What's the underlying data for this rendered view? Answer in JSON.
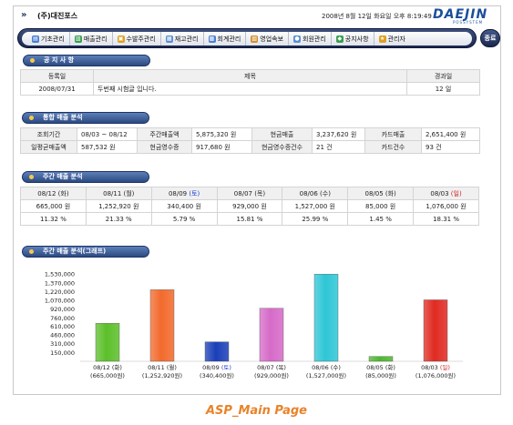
{
  "header": {
    "company": "(주)대진포스",
    "datetime": "2008년 8월 12일 화요일 오후 8:19:49",
    "logo_main": "DAEJIN",
    "logo_sub": "POSSYSTEM"
  },
  "nav": {
    "items": [
      {
        "label": "기초관리",
        "icon": "folder-icon",
        "color": "#4a7fd0"
      },
      {
        "label": "매출관리",
        "icon": "chart-icon",
        "color": "#3aa050"
      },
      {
        "label": "수발주관리",
        "icon": "box-icon",
        "color": "#e0a020"
      },
      {
        "label": "재고관리",
        "icon": "document-icon",
        "color": "#5a8fd0"
      },
      {
        "label": "회계관리",
        "icon": "calculator-icon",
        "color": "#4a7fd0"
      },
      {
        "label": "영업속보",
        "icon": "news-icon",
        "color": "#d09030"
      },
      {
        "label": "회원관리",
        "icon": "user-icon",
        "color": "#5a8fd0"
      },
      {
        "label": "공지사항",
        "icon": "notice-icon",
        "color": "#3aa050"
      },
      {
        "label": "관리자",
        "icon": "admin-icon",
        "color": "#e0a020"
      }
    ],
    "end_label": "종료"
  },
  "notice": {
    "title": "공 지 사 항",
    "columns": [
      "등록일",
      "제목",
      "경과일"
    ],
    "rows": [
      {
        "date": "2008/07/31",
        "subject": "두번째 시험글 입니다.",
        "elapsed": "12 일"
      }
    ]
  },
  "summary": {
    "title": "통합 매출 분석",
    "rows": [
      [
        {
          "label": "조회기간",
          "value": "08/03 ~ 08/12"
        },
        {
          "label": "주간매출액",
          "value": "5,875,320 원"
        },
        {
          "label": "현금매출",
          "value": "3,237,620 원"
        },
        {
          "label": "카드매출",
          "value": "2,651,400 원"
        }
      ],
      [
        {
          "label": "일평균매출액",
          "value": "587,532 원"
        },
        {
          "label": "현금영수증",
          "value": "917,680 원"
        },
        {
          "label": "현금영수증건수",
          "value": "21 건"
        },
        {
          "label": "카드건수",
          "value": "93 건"
        }
      ]
    ]
  },
  "weekly": {
    "title": "주간 매출 분석",
    "days": [
      {
        "date": "08/12 ",
        "dow": "(화)",
        "dow_color": "normal",
        "amount": "665,000 원",
        "percent": "11.32 %"
      },
      {
        "date": "08/11 ",
        "dow": "(월)",
        "dow_color": "normal",
        "amount": "1,252,920 원",
        "percent": "21.33 %"
      },
      {
        "date": "08/09 ",
        "dow": "(토)",
        "dow_color": "blue",
        "amount": "340,400 원",
        "percent": "5.79 %"
      },
      {
        "date": "08/07 ",
        "dow": "(목)",
        "dow_color": "normal",
        "amount": "929,000 원",
        "percent": "15.81 %"
      },
      {
        "date": "08/06 ",
        "dow": "(수)",
        "dow_color": "normal",
        "amount": "1,527,000 원",
        "percent": "25.99 %"
      },
      {
        "date": "08/05 ",
        "dow": "(화)",
        "dow_color": "normal",
        "amount": "85,000 원",
        "percent": "1.45 %"
      },
      {
        "date": "08/03 ",
        "dow": "(일)",
        "dow_color": "red",
        "amount": "1,076,000 원",
        "percent": "18.31 %"
      }
    ]
  },
  "graph": {
    "title": "주간 매출 분석(그래프)"
  },
  "chart_data": {
    "type": "bar",
    "categories": [
      "08/12",
      "08/11",
      "08/09",
      "08/07",
      "08/06",
      "08/05",
      "08/03"
    ],
    "category_dow": [
      "(화)",
      "(월)",
      "(토)",
      "(목)",
      "(수)",
      "(화)",
      "(일)"
    ],
    "category_dow_colors": [
      "#222222",
      "#222222",
      "#1c3fd0",
      "#222222",
      "#222222",
      "#222222",
      "#d0201c"
    ],
    "value_labels": [
      "(665,000원)",
      "(1,252,920원)",
      "(340,400원)",
      "(929,000원)",
      "(1,527,000원)",
      "(85,000원)",
      "(1,076,000원)"
    ],
    "values": [
      665000,
      1252920,
      340400,
      929000,
      1527000,
      85000,
      1076000
    ],
    "bar_colors": [
      "#5cbf2a",
      "#f26a2c",
      "#1a3fb8",
      "#d66ac8",
      "#2ec6d6",
      "#4db82e",
      "#e02a22"
    ],
    "yticks": [
      "1,530,000",
      "1,370,000",
      "1,220,000",
      "1,070,000",
      "920,000",
      "760,000",
      "610,000",
      "460,000",
      "310,000",
      "150,000"
    ],
    "ytick_values": [
      1530000,
      1370000,
      1220000,
      1070000,
      920000,
      760000,
      610000,
      460000,
      310000,
      150000
    ],
    "ylim": [
      0,
      1530000
    ],
    "grid": false
  },
  "caption": "ASP_Main Page"
}
